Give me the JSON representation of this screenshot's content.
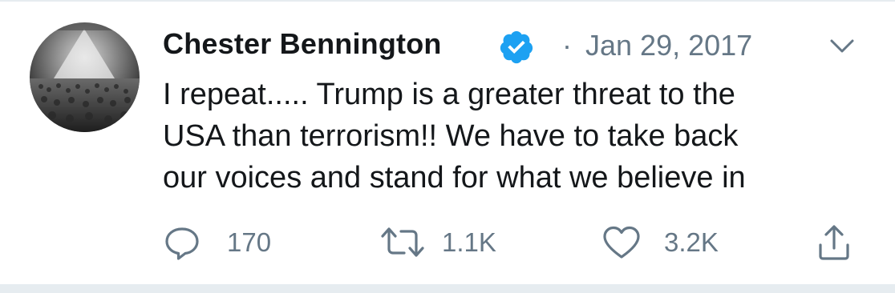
{
  "tweet": {
    "author_name": "Chester Bennington",
    "verified": true,
    "separator": "·",
    "date": "Jan 29, 2017",
    "text_lines": [
      "I repeat..... Trump is a greater threat to the",
      "USA than terrorism!! We have to take back",
      "our voices and stand for what we believe in"
    ],
    "actions": {
      "reply_count": "170",
      "retweet_count": "1.1K",
      "like_count": "3.2K"
    }
  },
  "icons": {
    "verified": "verified-badge-icon",
    "more": "chevron-down-icon",
    "reply": "reply-icon",
    "retweet": "retweet-icon",
    "like": "heart-icon",
    "share": "share-icon"
  },
  "colors": {
    "text_primary": "#14171a",
    "text_secondary": "#657786",
    "verified_blue": "#1da1f2",
    "divider": "#e6ecf0"
  }
}
